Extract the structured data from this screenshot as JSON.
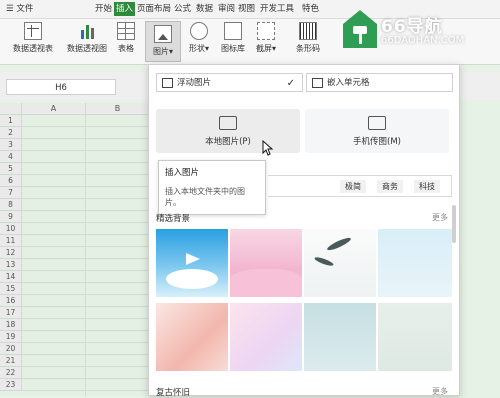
{
  "menubar": {
    "items": [
      "☰ 文件",
      "开始",
      "插入",
      "页面布局",
      "公式",
      "数据",
      "审阅",
      "视图",
      "开发工具",
      "特色"
    ]
  },
  "ribbon": {
    "buttons": [
      "数据透视表",
      "数据透视图",
      "表格",
      "图片",
      "形状",
      "图标库",
      "截屏",
      "条形码"
    ]
  },
  "formula": {
    "cell_ref": "H6"
  },
  "grid": {
    "columns": [
      "A",
      "B"
    ],
    "rows": [
      "1",
      "2",
      "3",
      "4",
      "5",
      "6",
      "7",
      "8",
      "9",
      "10",
      "11",
      "12",
      "13",
      "14",
      "15",
      "16",
      "17",
      "18",
      "19",
      "20",
      "21",
      "22",
      "23"
    ]
  },
  "panel": {
    "float_label": "浮动图片",
    "embed_label": "嵌入单元格",
    "local_btn": "本地图片(P)",
    "phone_btn": "手机传图(M)",
    "tooltip_title": "插入图片",
    "tooltip_desc": "插入本地文件夹中的图片。",
    "tags": [
      "极简",
      "商务",
      "科技"
    ],
    "section1_title": "精选背景",
    "section1_more": "更多",
    "section2_title": "复古怀旧",
    "section2_more": "更多"
  },
  "watermark": {
    "title": "66导航",
    "url": "66DAOHAN.COM"
  },
  "colors": {
    "accent": "#2f8a3c",
    "grid_bg": "#e3f0e3"
  }
}
